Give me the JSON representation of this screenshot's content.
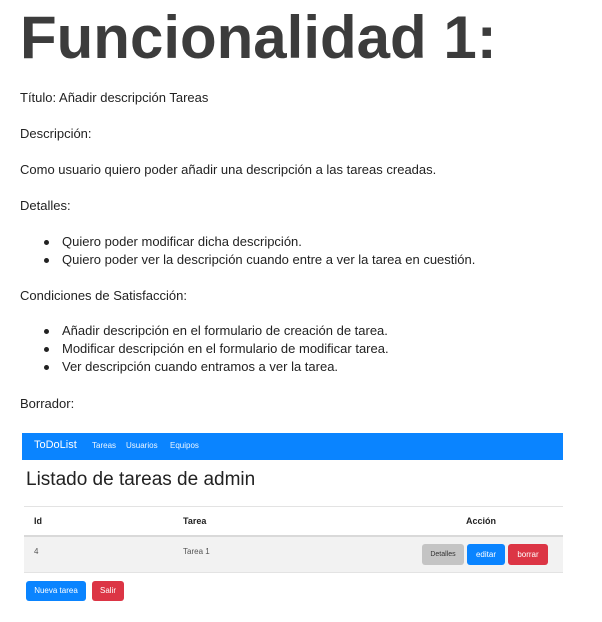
{
  "heading": "Funcionalidad 1:",
  "title_line": "Título: Añadir descripción Tareas",
  "description_label": "Descripción:",
  "description_text": "Como usuario quiero poder añadir una descripción a las tareas creadas.",
  "details_label": "Detalles:",
  "details_items": [
    "Quiero poder modificar dicha descripción.",
    "Quiero poder ver la descripción cuando entre a ver la tarea en cuestión."
  ],
  "conditions_label": "Condiciones de Satisfacción:",
  "conditions_items": [
    "Añadir descripción en el formulario de creación de tarea.",
    "Modificar descripción en el formulario de modificar tarea.",
    "Ver descripción cuando entramos a ver la tarea."
  ],
  "draft_label": "Borrador:",
  "mockup": {
    "brand": "ToDoList",
    "nav_links": [
      "Tareas",
      "Usuarios",
      "Equipos"
    ],
    "page_title": "Listado de tareas de admin",
    "columns": [
      "Id",
      "Tarea",
      "Acción"
    ],
    "rows": [
      {
        "id": "4",
        "tarea": "Tarea 1"
      }
    ],
    "row_buttons": {
      "details": "Detalles",
      "edit": "editar",
      "delete": "borrar"
    },
    "footer_buttons": {
      "new_task": "Nueva tarea",
      "exit": "Salir"
    },
    "colors": {
      "primary": "#0a84ff",
      "danger": "#dc3545",
      "secondary": "#c4c4c4"
    }
  }
}
